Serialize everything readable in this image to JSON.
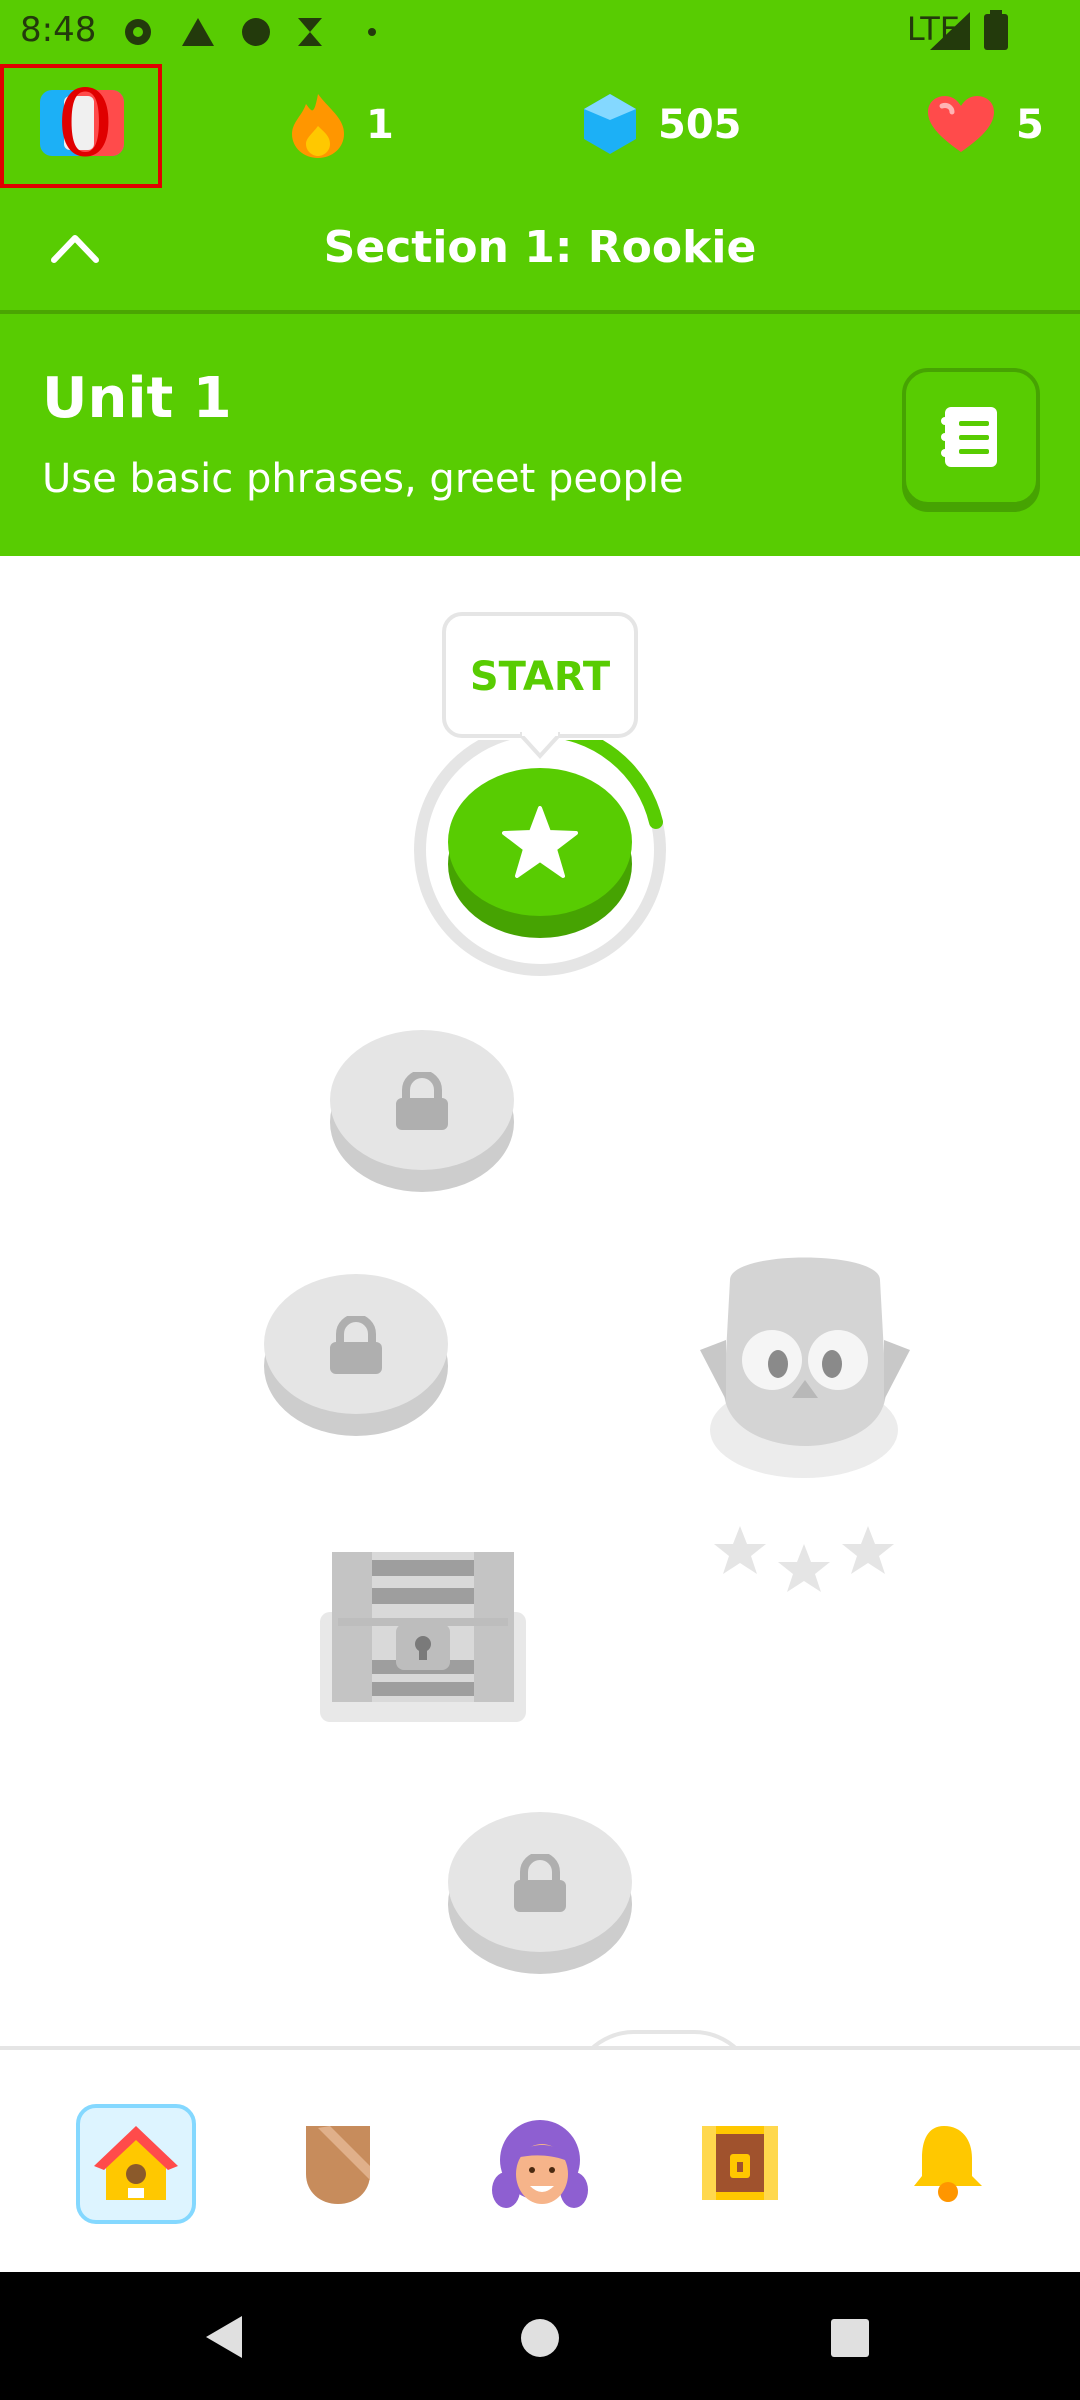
{
  "status_bar": {
    "time": "8:48",
    "network": "LTE"
  },
  "top_bar": {
    "streak": "1",
    "gems": "505",
    "hearts": "5"
  },
  "section": {
    "title": "Section 1: Rookie"
  },
  "unit": {
    "title": "Unit 1",
    "subtitle": "Use basic phrases, greet people"
  },
  "path": {
    "start_label": "START"
  },
  "annotation": {
    "index": "0"
  },
  "colors": {
    "primary": "#58cc02",
    "streak": "#ff9600",
    "gem": "#1cb0f6",
    "heart": "#ff4b4b",
    "locked": "#e5e5e5"
  },
  "icons": [
    "flag-icon",
    "streak-flame-icon",
    "gem-icon",
    "heart-icon",
    "chevron-up-icon",
    "guidebook-icon",
    "star-icon",
    "lock-icon",
    "treasure-chest-icon",
    "owl-icon",
    "home-icon",
    "shield-icon",
    "character-icon",
    "chest-icon",
    "bell-icon",
    "back-icon",
    "home-circle-icon",
    "recents-icon"
  ]
}
